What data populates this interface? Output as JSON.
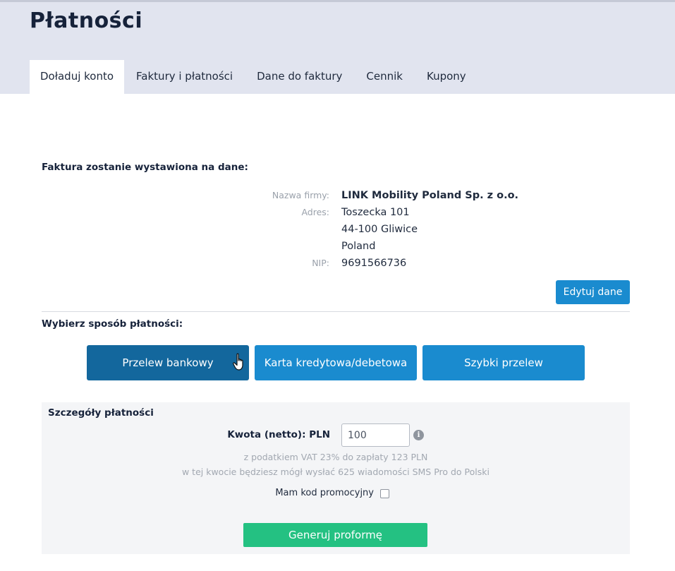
{
  "header": {
    "title": "Płatności",
    "tabs": [
      {
        "label": "Doładuj konto",
        "active": true
      },
      {
        "label": "Faktury i płatności"
      },
      {
        "label": "Dane do faktury"
      },
      {
        "label": "Cennik"
      },
      {
        "label": "Kupony"
      }
    ]
  },
  "invoice": {
    "heading": "Faktura zostanie wystawiona na dane:",
    "company_label": "Nazwa firmy:",
    "company_value": "LINK Mobility Poland Sp. z o.o.",
    "address_label": "Adres:",
    "address_lines": [
      "Toszecka 101",
      "44-100 Gliwice",
      "Poland"
    ],
    "nip_label": "NIP:",
    "nip_value": "9691566736",
    "edit_button": "Edytuj dane"
  },
  "payment": {
    "heading": "Wybierz sposób płatności:",
    "methods": [
      "Przelew bankowy",
      "Karta kredytowa/debetowa",
      "Szybki przelew"
    ],
    "selected": "Przelew bankowy"
  },
  "details": {
    "title": "Szczegóły płatności",
    "amount_label": "Kwota (netto): PLN",
    "amount_value": "100",
    "info_glyph": "i",
    "vat_note": "z podatkiem VAT 23% do zapłaty 123 PLN",
    "sms_note": "w tej kwocie będziesz mógł wysłać 625 wiadomości SMS Pro do Polski",
    "promo_label": "Mam kod promocyjny",
    "promo_checked": false,
    "generate_button": "Generuj proformę"
  },
  "colors": {
    "header_bg": "#e1e4ef",
    "primary": "#1a8bcf",
    "primary_active": "#13679d",
    "success": "#24c182",
    "panel_bg": "#f4f5f7"
  },
  "icons": {
    "info": "info-circle-icon",
    "cursor": "hand-pointer-icon"
  }
}
